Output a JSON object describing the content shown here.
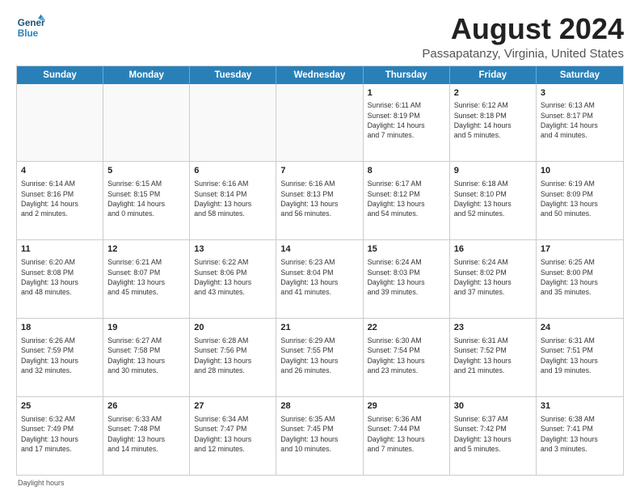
{
  "logo": {
    "line1": "General",
    "line2": "Blue"
  },
  "title": "August 2024",
  "subtitle": "Passapatanzy, Virginia, United States",
  "day_headers": [
    "Sunday",
    "Monday",
    "Tuesday",
    "Wednesday",
    "Thursday",
    "Friday",
    "Saturday"
  ],
  "footer": "Daylight hours",
  "weeks": [
    [
      {
        "date": "",
        "info": ""
      },
      {
        "date": "",
        "info": ""
      },
      {
        "date": "",
        "info": ""
      },
      {
        "date": "",
        "info": ""
      },
      {
        "date": "1",
        "info": "Sunrise: 6:11 AM\nSunset: 8:19 PM\nDaylight: 14 hours\nand 7 minutes."
      },
      {
        "date": "2",
        "info": "Sunrise: 6:12 AM\nSunset: 8:18 PM\nDaylight: 14 hours\nand 5 minutes."
      },
      {
        "date": "3",
        "info": "Sunrise: 6:13 AM\nSunset: 8:17 PM\nDaylight: 14 hours\nand 4 minutes."
      }
    ],
    [
      {
        "date": "4",
        "info": "Sunrise: 6:14 AM\nSunset: 8:16 PM\nDaylight: 14 hours\nand 2 minutes."
      },
      {
        "date": "5",
        "info": "Sunrise: 6:15 AM\nSunset: 8:15 PM\nDaylight: 14 hours\nand 0 minutes."
      },
      {
        "date": "6",
        "info": "Sunrise: 6:16 AM\nSunset: 8:14 PM\nDaylight: 13 hours\nand 58 minutes."
      },
      {
        "date": "7",
        "info": "Sunrise: 6:16 AM\nSunset: 8:13 PM\nDaylight: 13 hours\nand 56 minutes."
      },
      {
        "date": "8",
        "info": "Sunrise: 6:17 AM\nSunset: 8:12 PM\nDaylight: 13 hours\nand 54 minutes."
      },
      {
        "date": "9",
        "info": "Sunrise: 6:18 AM\nSunset: 8:10 PM\nDaylight: 13 hours\nand 52 minutes."
      },
      {
        "date": "10",
        "info": "Sunrise: 6:19 AM\nSunset: 8:09 PM\nDaylight: 13 hours\nand 50 minutes."
      }
    ],
    [
      {
        "date": "11",
        "info": "Sunrise: 6:20 AM\nSunset: 8:08 PM\nDaylight: 13 hours\nand 48 minutes."
      },
      {
        "date": "12",
        "info": "Sunrise: 6:21 AM\nSunset: 8:07 PM\nDaylight: 13 hours\nand 45 minutes."
      },
      {
        "date": "13",
        "info": "Sunrise: 6:22 AM\nSunset: 8:06 PM\nDaylight: 13 hours\nand 43 minutes."
      },
      {
        "date": "14",
        "info": "Sunrise: 6:23 AM\nSunset: 8:04 PM\nDaylight: 13 hours\nand 41 minutes."
      },
      {
        "date": "15",
        "info": "Sunrise: 6:24 AM\nSunset: 8:03 PM\nDaylight: 13 hours\nand 39 minutes."
      },
      {
        "date": "16",
        "info": "Sunrise: 6:24 AM\nSunset: 8:02 PM\nDaylight: 13 hours\nand 37 minutes."
      },
      {
        "date": "17",
        "info": "Sunrise: 6:25 AM\nSunset: 8:00 PM\nDaylight: 13 hours\nand 35 minutes."
      }
    ],
    [
      {
        "date": "18",
        "info": "Sunrise: 6:26 AM\nSunset: 7:59 PM\nDaylight: 13 hours\nand 32 minutes."
      },
      {
        "date": "19",
        "info": "Sunrise: 6:27 AM\nSunset: 7:58 PM\nDaylight: 13 hours\nand 30 minutes."
      },
      {
        "date": "20",
        "info": "Sunrise: 6:28 AM\nSunset: 7:56 PM\nDaylight: 13 hours\nand 28 minutes."
      },
      {
        "date": "21",
        "info": "Sunrise: 6:29 AM\nSunset: 7:55 PM\nDaylight: 13 hours\nand 26 minutes."
      },
      {
        "date": "22",
        "info": "Sunrise: 6:30 AM\nSunset: 7:54 PM\nDaylight: 13 hours\nand 23 minutes."
      },
      {
        "date": "23",
        "info": "Sunrise: 6:31 AM\nSunset: 7:52 PM\nDaylight: 13 hours\nand 21 minutes."
      },
      {
        "date": "24",
        "info": "Sunrise: 6:31 AM\nSunset: 7:51 PM\nDaylight: 13 hours\nand 19 minutes."
      }
    ],
    [
      {
        "date": "25",
        "info": "Sunrise: 6:32 AM\nSunset: 7:49 PM\nDaylight: 13 hours\nand 17 minutes."
      },
      {
        "date": "26",
        "info": "Sunrise: 6:33 AM\nSunset: 7:48 PM\nDaylight: 13 hours\nand 14 minutes."
      },
      {
        "date": "27",
        "info": "Sunrise: 6:34 AM\nSunset: 7:47 PM\nDaylight: 13 hours\nand 12 minutes."
      },
      {
        "date": "28",
        "info": "Sunrise: 6:35 AM\nSunset: 7:45 PM\nDaylight: 13 hours\nand 10 minutes."
      },
      {
        "date": "29",
        "info": "Sunrise: 6:36 AM\nSunset: 7:44 PM\nDaylight: 13 hours\nand 7 minutes."
      },
      {
        "date": "30",
        "info": "Sunrise: 6:37 AM\nSunset: 7:42 PM\nDaylight: 13 hours\nand 5 minutes."
      },
      {
        "date": "31",
        "info": "Sunrise: 6:38 AM\nSunset: 7:41 PM\nDaylight: 13 hours\nand 3 minutes."
      }
    ]
  ]
}
